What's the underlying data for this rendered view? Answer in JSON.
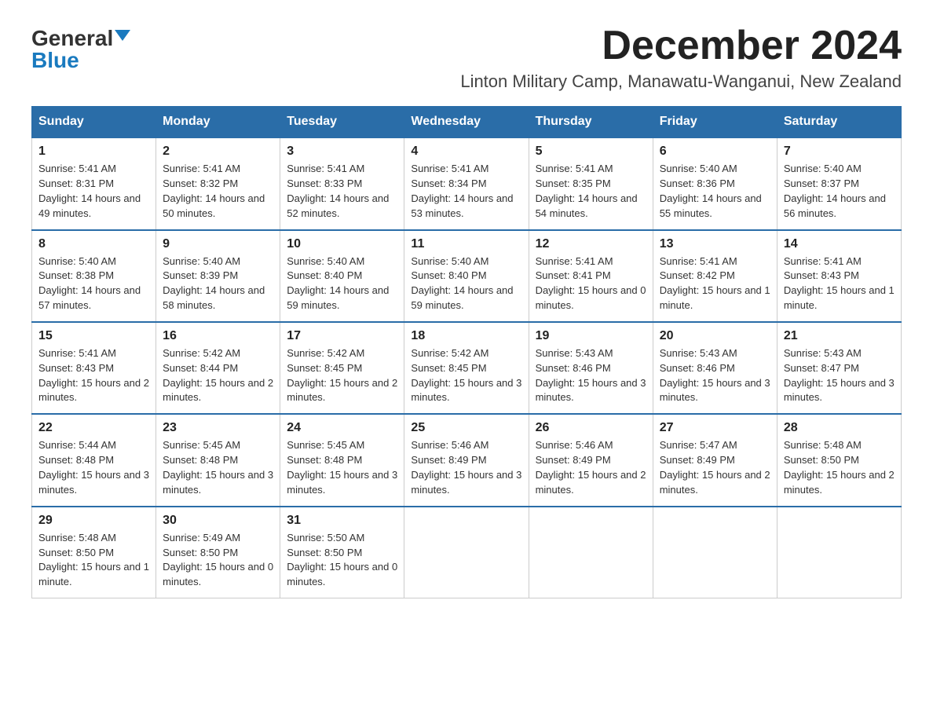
{
  "header": {
    "logo_general": "General",
    "logo_blue": "Blue",
    "month_title": "December 2024",
    "location": "Linton Military Camp, Manawatu-Wanganui, New Zealand"
  },
  "days_of_week": [
    "Sunday",
    "Monday",
    "Tuesday",
    "Wednesday",
    "Thursday",
    "Friday",
    "Saturday"
  ],
  "weeks": [
    [
      {
        "day": "1",
        "sunrise": "5:41 AM",
        "sunset": "8:31 PM",
        "daylight": "14 hours and 49 minutes."
      },
      {
        "day": "2",
        "sunrise": "5:41 AM",
        "sunset": "8:32 PM",
        "daylight": "14 hours and 50 minutes."
      },
      {
        "day": "3",
        "sunrise": "5:41 AM",
        "sunset": "8:33 PM",
        "daylight": "14 hours and 52 minutes."
      },
      {
        "day": "4",
        "sunrise": "5:41 AM",
        "sunset": "8:34 PM",
        "daylight": "14 hours and 53 minutes."
      },
      {
        "day": "5",
        "sunrise": "5:41 AM",
        "sunset": "8:35 PM",
        "daylight": "14 hours and 54 minutes."
      },
      {
        "day": "6",
        "sunrise": "5:40 AM",
        "sunset": "8:36 PM",
        "daylight": "14 hours and 55 minutes."
      },
      {
        "day": "7",
        "sunrise": "5:40 AM",
        "sunset": "8:37 PM",
        "daylight": "14 hours and 56 minutes."
      }
    ],
    [
      {
        "day": "8",
        "sunrise": "5:40 AM",
        "sunset": "8:38 PM",
        "daylight": "14 hours and 57 minutes."
      },
      {
        "day": "9",
        "sunrise": "5:40 AM",
        "sunset": "8:39 PM",
        "daylight": "14 hours and 58 minutes."
      },
      {
        "day": "10",
        "sunrise": "5:40 AM",
        "sunset": "8:40 PM",
        "daylight": "14 hours and 59 minutes."
      },
      {
        "day": "11",
        "sunrise": "5:40 AM",
        "sunset": "8:40 PM",
        "daylight": "14 hours and 59 minutes."
      },
      {
        "day": "12",
        "sunrise": "5:41 AM",
        "sunset": "8:41 PM",
        "daylight": "15 hours and 0 minutes."
      },
      {
        "day": "13",
        "sunrise": "5:41 AM",
        "sunset": "8:42 PM",
        "daylight": "15 hours and 1 minute."
      },
      {
        "day": "14",
        "sunrise": "5:41 AM",
        "sunset": "8:43 PM",
        "daylight": "15 hours and 1 minute."
      }
    ],
    [
      {
        "day": "15",
        "sunrise": "5:41 AM",
        "sunset": "8:43 PM",
        "daylight": "15 hours and 2 minutes."
      },
      {
        "day": "16",
        "sunrise": "5:42 AM",
        "sunset": "8:44 PM",
        "daylight": "15 hours and 2 minutes."
      },
      {
        "day": "17",
        "sunrise": "5:42 AM",
        "sunset": "8:45 PM",
        "daylight": "15 hours and 2 minutes."
      },
      {
        "day": "18",
        "sunrise": "5:42 AM",
        "sunset": "8:45 PM",
        "daylight": "15 hours and 3 minutes."
      },
      {
        "day": "19",
        "sunrise": "5:43 AM",
        "sunset": "8:46 PM",
        "daylight": "15 hours and 3 minutes."
      },
      {
        "day": "20",
        "sunrise": "5:43 AM",
        "sunset": "8:46 PM",
        "daylight": "15 hours and 3 minutes."
      },
      {
        "day": "21",
        "sunrise": "5:43 AM",
        "sunset": "8:47 PM",
        "daylight": "15 hours and 3 minutes."
      }
    ],
    [
      {
        "day": "22",
        "sunrise": "5:44 AM",
        "sunset": "8:48 PM",
        "daylight": "15 hours and 3 minutes."
      },
      {
        "day": "23",
        "sunrise": "5:45 AM",
        "sunset": "8:48 PM",
        "daylight": "15 hours and 3 minutes."
      },
      {
        "day": "24",
        "sunrise": "5:45 AM",
        "sunset": "8:48 PM",
        "daylight": "15 hours and 3 minutes."
      },
      {
        "day": "25",
        "sunrise": "5:46 AM",
        "sunset": "8:49 PM",
        "daylight": "15 hours and 3 minutes."
      },
      {
        "day": "26",
        "sunrise": "5:46 AM",
        "sunset": "8:49 PM",
        "daylight": "15 hours and 2 minutes."
      },
      {
        "day": "27",
        "sunrise": "5:47 AM",
        "sunset": "8:49 PM",
        "daylight": "15 hours and 2 minutes."
      },
      {
        "day": "28",
        "sunrise": "5:48 AM",
        "sunset": "8:50 PM",
        "daylight": "15 hours and 2 minutes."
      }
    ],
    [
      {
        "day": "29",
        "sunrise": "5:48 AM",
        "sunset": "8:50 PM",
        "daylight": "15 hours and 1 minute."
      },
      {
        "day": "30",
        "sunrise": "5:49 AM",
        "sunset": "8:50 PM",
        "daylight": "15 hours and 0 minutes."
      },
      {
        "day": "31",
        "sunrise": "5:50 AM",
        "sunset": "8:50 PM",
        "daylight": "15 hours and 0 minutes."
      },
      null,
      null,
      null,
      null
    ]
  ]
}
